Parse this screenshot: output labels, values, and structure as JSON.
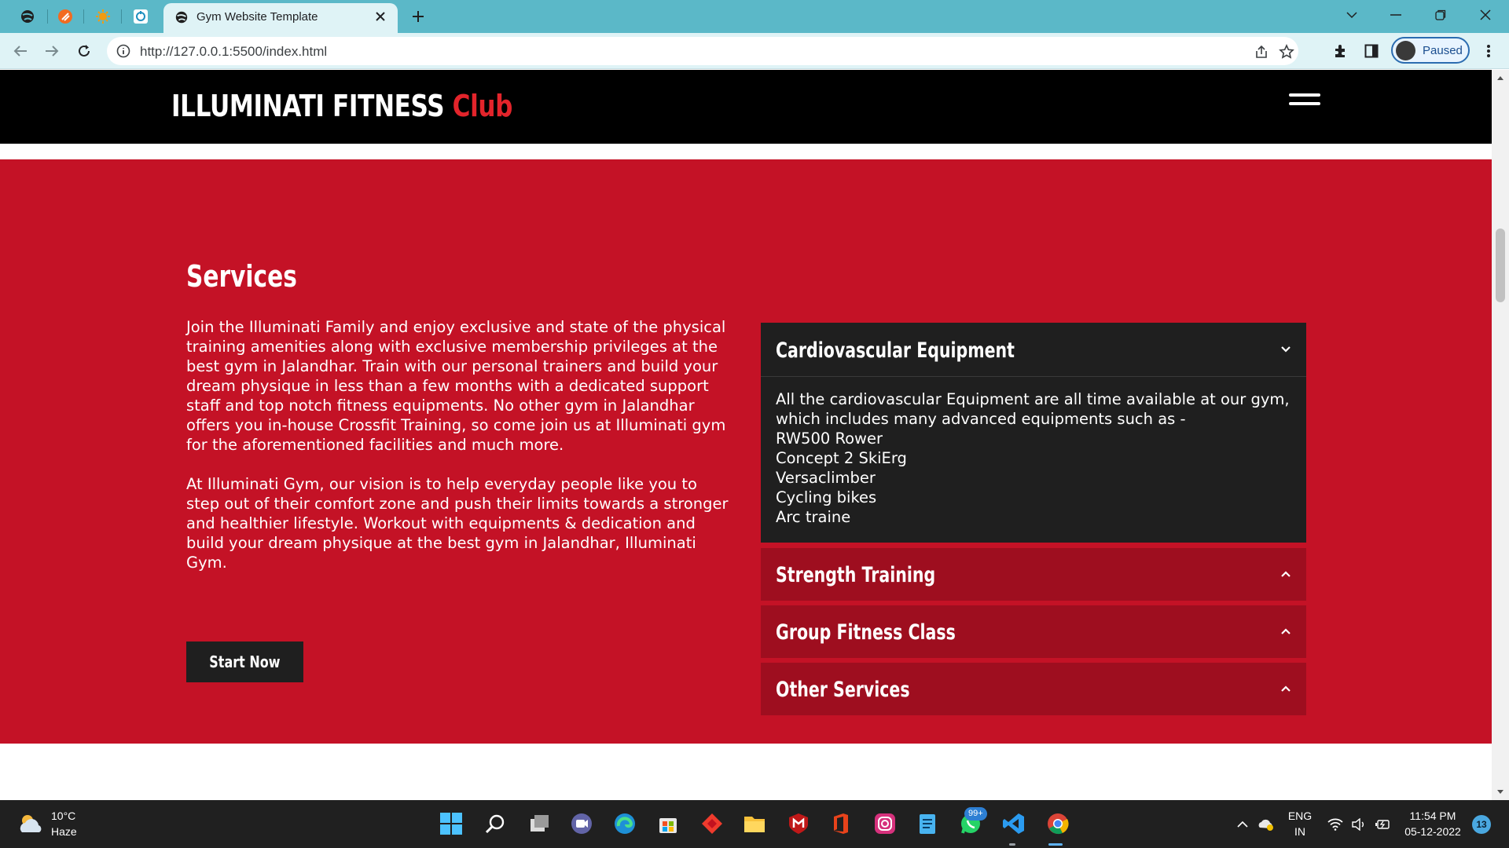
{
  "browser": {
    "active_tab_title": "Gym Website Template",
    "url": "http://127.0.0.1:5500/index.html",
    "profile_label": "Paused"
  },
  "site": {
    "brand_main": "ILLUMINATI FITNESS",
    "brand_accent": "Club",
    "services": {
      "title": "Services",
      "paragraph1": "Join the Illuminati Family and enjoy exclusive and state of the physical training amenities along with exclusive membership privileges at the best gym in Jalandhar. Train with our personal trainers and build your dream physique in less than a few months with a dedicated support staff and top notch fitness equipments. No other gym in Jalandhar offers you in-house Crossfit Training, so come join us at Illuminati gym for the aforementioned facilities and much more.",
      "paragraph2": "At Illuminati Gym, our vision is to help everyday people like you to step out of their comfort zone and push their limits towards a stronger and healthier lifestyle. Workout with equipments & dedication and build your dream physique at the best gym in Jalandhar, Illuminati Gym.",
      "cta_label": "Start Now"
    },
    "accordion": [
      {
        "title": "Cardiovascular Equipment",
        "intro": "All the cardiovascular Equipment are all time available at our gym, which includes many advanced equipments such as -",
        "items": [
          "RW500 Rower",
          "Concept 2 SkiErg",
          "Versaclimber",
          "Cycling bikes",
          "Arc traine"
        ]
      },
      {
        "title": "Strength Training"
      },
      {
        "title": "Group Fitness Class"
      },
      {
        "title": "Other Services"
      }
    ]
  },
  "taskbar": {
    "weather_temp": "10°C",
    "weather_desc": "Haze",
    "whatsapp_badge": "99+",
    "lang_top": "ENG",
    "lang_bottom": "IN",
    "time": "11:54 PM",
    "date": "05-12-2022",
    "notification_count": "13"
  },
  "colors": {
    "services_bg": "#c41226",
    "brand_accent": "#e3242b",
    "accordion_open_bg": "#1f1f1f",
    "accordion_closed_bg": "#9e0e1f"
  }
}
